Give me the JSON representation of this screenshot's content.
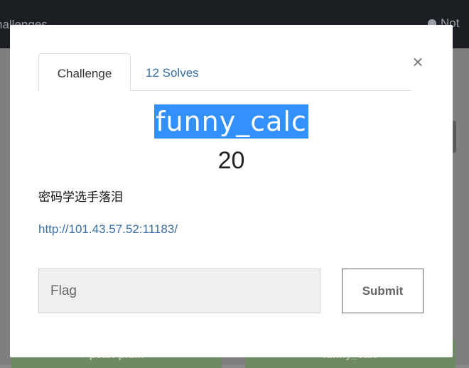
{
  "background": {
    "nav_left_text": "hallenges",
    "nav_right_text": "Not",
    "card_left_label": "pearl-plum",
    "card_right_label": "funny_calc"
  },
  "modal": {
    "close_glyph": "×",
    "tabs": [
      {
        "label": "Challenge",
        "active": true
      },
      {
        "label": "12 Solves",
        "active": false
      }
    ],
    "title": "funny_calc",
    "points": "20",
    "description": "密码学选手落泪",
    "link": "http://101.43.57.52:11183/",
    "flag_input": {
      "value": "",
      "placeholder": "Flag"
    },
    "submit_label": "Submit"
  },
  "colors": {
    "selection_highlight": "#3390ff",
    "link": "#3a6ea5",
    "navbar": "#1b1f23",
    "card_green": "#6f8a63"
  },
  "icons": {
    "close": "close-icon",
    "notifications": "bell-icon"
  }
}
